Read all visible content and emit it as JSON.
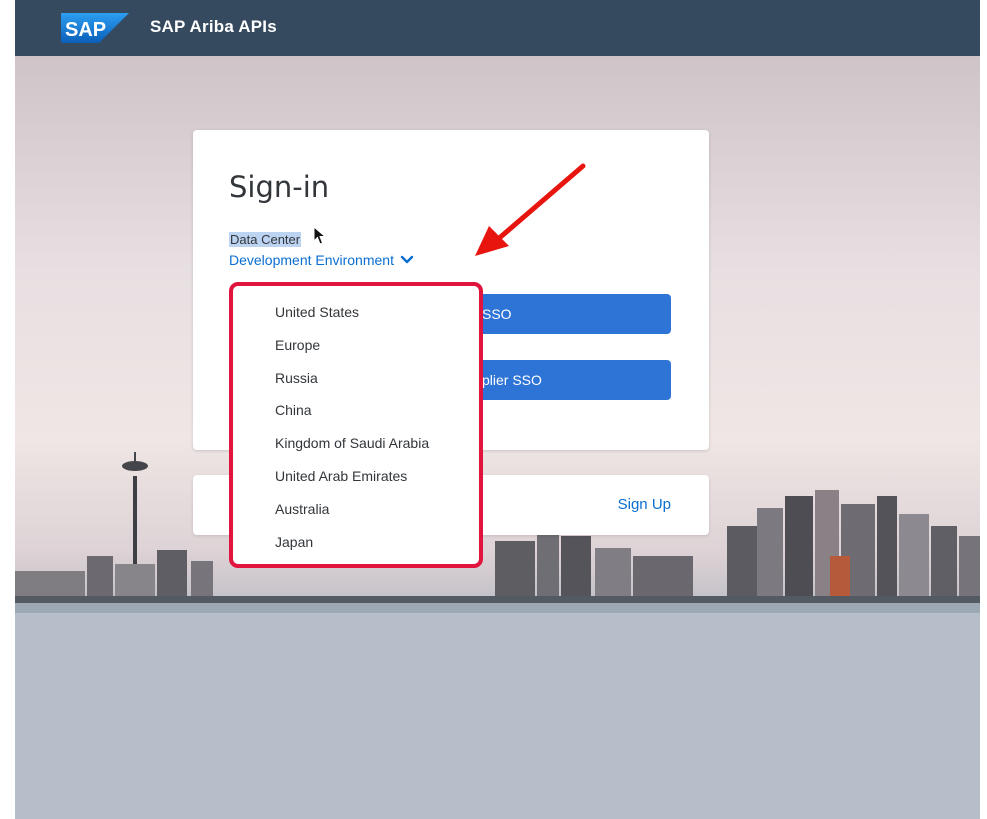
{
  "header": {
    "logo_text": "SAP",
    "title": "SAP Ariba APIs",
    "background_color": "#354a5f"
  },
  "signin": {
    "title": "Sign-in",
    "data_center_label": "Data Center",
    "selected_environment": "Development Environment",
    "primary_button_label": "SSO",
    "secondary_button_label": "plier SSO"
  },
  "signup_card": {
    "signup_link": "Sign Up"
  },
  "data_center_dropdown": {
    "options": [
      "United States",
      "Europe",
      "Russia",
      "China",
      "Kingdom of Saudi Arabia",
      "United Arab Emirates",
      "Australia",
      "Japan"
    ],
    "highlight_color": "#e0143c"
  },
  "colors": {
    "accent": "#0a6ed1",
    "button": "#2e73d6",
    "annotation_arrow": "#e8140e"
  },
  "icons": {
    "dropdown": "chevron-down-icon",
    "pointer": "mouse-cursor-icon",
    "annotation": "red-arrow-icon"
  }
}
